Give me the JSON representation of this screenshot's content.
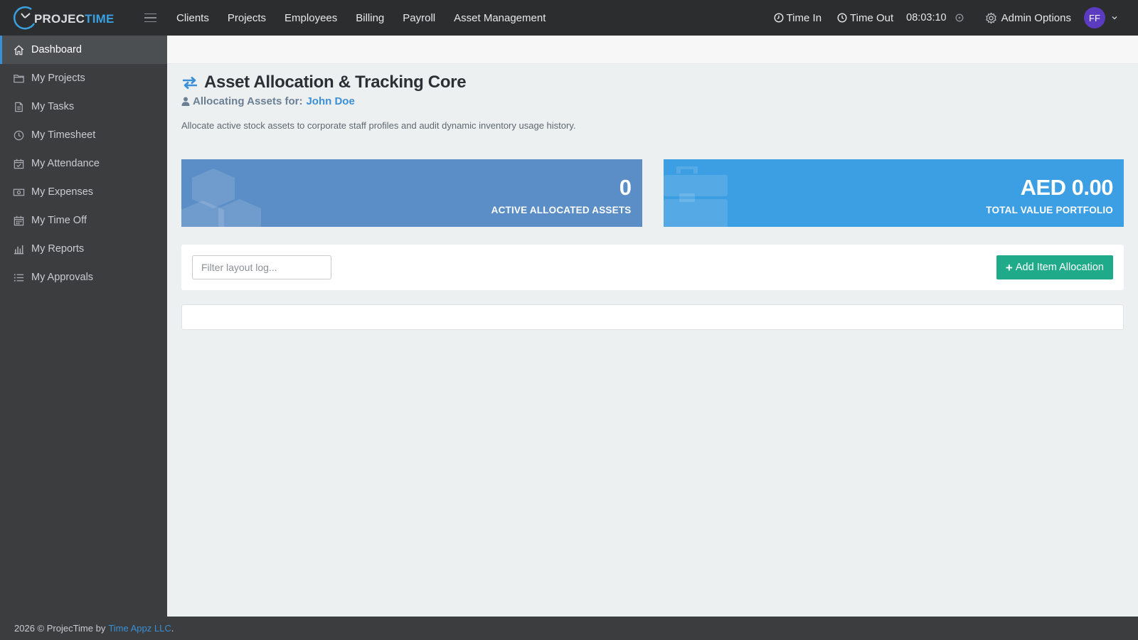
{
  "app": {
    "logo_part1": "PROJEC",
    "logo_part2": "TIME"
  },
  "topnav": {
    "items": [
      "Clients",
      "Projects",
      "Employees",
      "Billing",
      "Payroll",
      "Asset Management"
    ]
  },
  "topright": {
    "time_in": "Time In",
    "time_out": "Time Out",
    "clock": "08:03:10",
    "admin": "Admin Options",
    "avatar_initials": "FF"
  },
  "sidebar": {
    "items": [
      {
        "label": "Dashboard",
        "icon": "home-icon",
        "active": true
      },
      {
        "label": "My Projects",
        "icon": "folder-icon"
      },
      {
        "label": "My Tasks",
        "icon": "tasks-icon"
      },
      {
        "label": "My Timesheet",
        "icon": "clock-icon"
      },
      {
        "label": "My Attendance",
        "icon": "calendar-check-icon"
      },
      {
        "label": "My Expenses",
        "icon": "money-icon"
      },
      {
        "label": "My Time Off",
        "icon": "calendar-icon"
      },
      {
        "label": "My Reports",
        "icon": "bar-chart-icon"
      },
      {
        "label": "My Approvals",
        "icon": "list-icon"
      }
    ]
  },
  "page": {
    "title": "Asset Allocation & Tracking Core",
    "subtitle_prefix": "Allocating Assets for:",
    "person": "John Doe",
    "description": "Allocate active stock assets to corporate staff profiles and audit dynamic inventory usage history."
  },
  "cards": [
    {
      "value": "0",
      "label": "ACTIVE ALLOCATED ASSETS",
      "color": "#5b8ec6"
    },
    {
      "value": "AED 0.00",
      "label": "TOTAL VALUE PORTFOLIO",
      "color": "#3c9ee3"
    }
  ],
  "toolbar": {
    "filter_placeholder": "Filter layout log...",
    "add_label": "Add Item Allocation"
  },
  "footer": {
    "text": "2026 © ProjecTime by",
    "link": "Time Appz LLC",
    "suffix": "."
  },
  "colors": {
    "accent": "#3a8fd6",
    "success": "#1fab89",
    "topbar": "#2b2d2f",
    "sidebar": "#3b3d3f"
  }
}
